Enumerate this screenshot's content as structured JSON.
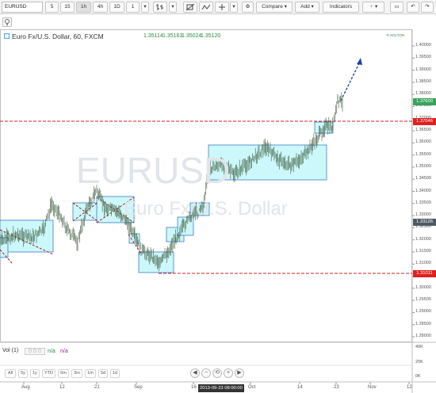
{
  "toolbar": {
    "symbol": "EURUSD",
    "intervals": [
      "5",
      "15",
      "1h",
      "4h",
      "1D",
      "1"
    ],
    "compare_label": "Compare",
    "add_label": "Add",
    "indicators_label": "Indicators"
  },
  "chart_header": {
    "title": "Euro Fx/U.S. Dollar, 60, FXCM",
    "open": "1.35114",
    "high": "1.35163",
    "low": "1.35024",
    "close": "1.35120"
  },
  "watermark": {
    "symbol": "EURUSD",
    "name": "Euro Fx/U.S. Dollar"
  },
  "price_axis": {
    "ticks": [
      "1.40000",
      "1.39500",
      "1.39000",
      "1.38500",
      "1.38000",
      "1.37500",
      "1.37000",
      "1.36500",
      "1.36000",
      "1.35500",
      "1.35000",
      "1.34500",
      "1.34000",
      "1.33500",
      "1.33000",
      "1.32500",
      "1.32000",
      "1.31500",
      "1.31000",
      "1.30500",
      "1.30000",
      "1.29500",
      "1.29000",
      "1.28500",
      "1.28000"
    ],
    "last_price": "1.37600",
    "resistance_level": "1.37046",
    "gray_level": "1.33126",
    "support_level": "1.31011"
  },
  "volume_panel": {
    "label": "Vol (1)",
    "na1": "n/a",
    "na2": "n/a",
    "ticks": [
      "40K",
      "20K",
      "0K"
    ]
  },
  "date_ranges": [
    "All",
    "5y",
    "1y",
    "YTD",
    "6m",
    "3m",
    "1m",
    "5d",
    "1d"
  ],
  "time_axis": {
    "labels": [
      "Aug",
      "12",
      "21",
      "Sep",
      "16",
      "Oct",
      "14",
      "23",
      "Nov",
      "12"
    ],
    "crosshair_date": "2013-09-23 08:00:00"
  },
  "colors": {
    "box_fill": "#cdf8fb",
    "box_border": "#3a7bc8",
    "candle": "#3c5b3c",
    "red_line": "#d42020",
    "arrow": "#2040b0",
    "last_price_tag": "#3aa35e",
    "level_tag": "#e02020",
    "gray_tag": "#505a64"
  }
}
